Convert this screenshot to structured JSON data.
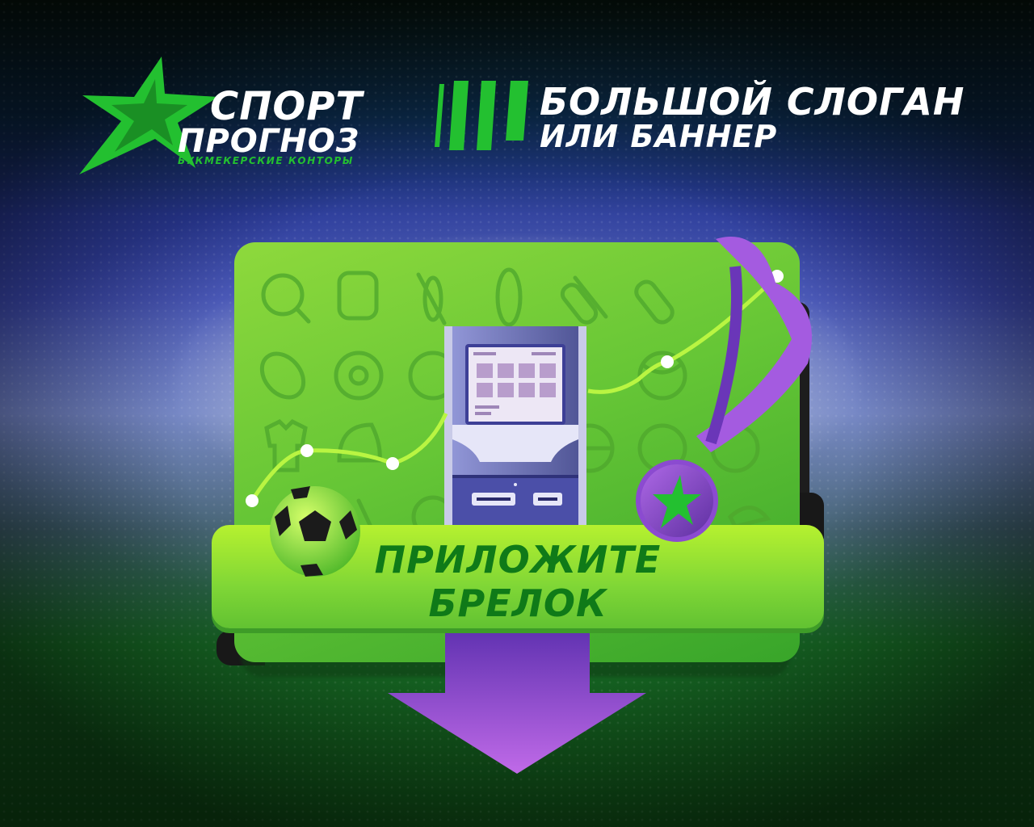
{
  "logo": {
    "line1": "СПОРТ",
    "line2": "ПРОГНОЗ",
    "subtitle": "БУКМЕКЕРСКИЕ КОНТОРЫ",
    "star_color": "#23c030"
  },
  "slogan": {
    "line1": "БОЛЬШОЙ СЛОГАН",
    "line2": "ИЛИ БАННЕР"
  },
  "banner": {
    "cta_line1": "ПРИЛОЖИТЕ",
    "cta_line2": "БРЕЛОК",
    "board_color": "#6cc836",
    "cta_color": "#0f7a18",
    "arrow_color": "#9b4fd8",
    "medal_ribbon_color": "#a45be0",
    "line_color": "#b9f542"
  },
  "icons": [
    "ping-pong-icon",
    "boxing-glove-icon",
    "kayak-icon",
    "surfboard-icon",
    "skateboard-icon",
    "snowboard-icon",
    "rugby-ball-icon",
    "billiard-ball-icon",
    "tennis-ball-icon",
    "volleyball-icon",
    "jersey-icon",
    "helmet-icon",
    "basketball-icon",
    "soccer-ball-icon",
    "stopwatch-icon",
    "ski-icon",
    "cap-icon"
  ]
}
